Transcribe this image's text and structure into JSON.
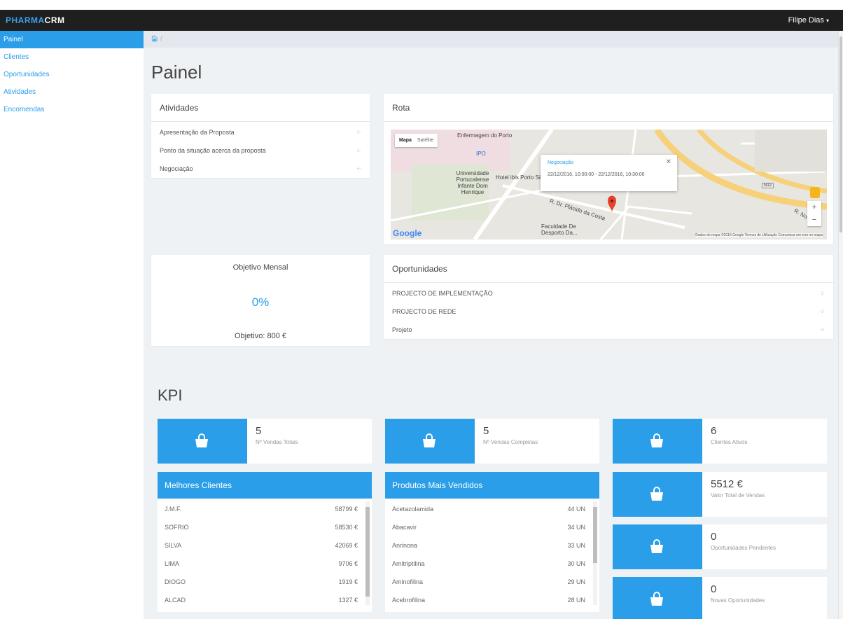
{
  "brand": {
    "part1": "PHARMA",
    "part2": "CRM"
  },
  "user": {
    "name": "Filipe Dias"
  },
  "sidebar": {
    "items": [
      {
        "label": "Painel"
      },
      {
        "label": "Clientes"
      },
      {
        "label": "Oportunidades"
      },
      {
        "label": "Atividades"
      },
      {
        "label": "Encomendas"
      }
    ]
  },
  "breadcrumb": {
    "separator": "/"
  },
  "page": {
    "title": "Painel",
    "kpi_title": "KPI"
  },
  "atividades": {
    "title": "Atividades",
    "items": [
      {
        "label": "Apresentação da Proposta"
      },
      {
        "label": "Ponto da situação acerca da proposta"
      },
      {
        "label": "Negociação"
      }
    ]
  },
  "rota": {
    "title": "Rota",
    "map_type_on": "Mapa",
    "map_type_off": "Satélite",
    "info_title": "Negociação",
    "info_date": "22/12/2016, 10:00:00 - 22/12/2016, 10:30:00",
    "labels": {
      "enfermagem": "Enfermagem do Porto",
      "ipo": "IPO",
      "universidade": "Universidade Portucalense Infante Dom Henrique",
      "ibis": "Hotel ibis Porto Sã",
      "placido": "R. Dr. Plácido da Costa",
      "faculdade": "Faculdade De Desporto Da...",
      "n12": "N12",
      "novo": "R. Nova"
    },
    "google": "Google",
    "footer": "Dados do mapa ©2016 Google   Termos de Utilização   Comunicar um erro no mapa"
  },
  "objetivo": {
    "title": "Objetivo Mensal",
    "percent": "0%",
    "value": "Objetivo: 800 €",
    "progress": 0
  },
  "oportunidades": {
    "title": "Oportunidades",
    "items": [
      {
        "label": "PROJECTO DE IMPLEMENTAÇÃO"
      },
      {
        "label": "PROJECTO DE REDE"
      },
      {
        "label": "Projeto"
      }
    ]
  },
  "kpis": [
    {
      "value": "5",
      "label": "Nº Vendas Totais"
    },
    {
      "value": "5",
      "label": "Nº Vendas Completas"
    },
    {
      "value": "6",
      "label": "Clientes Ativos"
    },
    {
      "value": "5512 €",
      "label": "Valor Total de Vendas"
    },
    {
      "value": "0",
      "label": "Oportunidades Pendentes"
    },
    {
      "value": "0",
      "label": "Novas Oportunidades"
    }
  ],
  "melhores_clientes": {
    "title": "Melhores Clientes",
    "rows": [
      {
        "name": "J.M.F.",
        "value": "58799 €"
      },
      {
        "name": "SOFRIO",
        "value": "58530 €"
      },
      {
        "name": "SILVA",
        "value": "42069 €"
      },
      {
        "name": "LIMA",
        "value": "9706 €"
      },
      {
        "name": "DIOGO",
        "value": "1919 €"
      },
      {
        "name": "ALCAD",
        "value": "1327 €"
      }
    ]
  },
  "produtos": {
    "title": "Produtos Mais Vendidos",
    "rows": [
      {
        "name": "Acetazolamida",
        "value": "44 UN"
      },
      {
        "name": "Abacavir",
        "value": "34 UN"
      },
      {
        "name": "Anrinona",
        "value": "33 UN"
      },
      {
        "name": "Amitriptilina",
        "value": "30 UN"
      },
      {
        "name": "Aminofilina",
        "value": "29 UN"
      },
      {
        "name": "Acebrofilina",
        "value": "28 UN"
      }
    ]
  },
  "icons": {
    "home": "home-icon",
    "spinner": "spinner-icon",
    "bag": "shopping-bag-icon"
  },
  "colors": {
    "accent": "#2a9ee8",
    "topbar": "#1f1f1f",
    "background": "#eff2f5"
  }
}
